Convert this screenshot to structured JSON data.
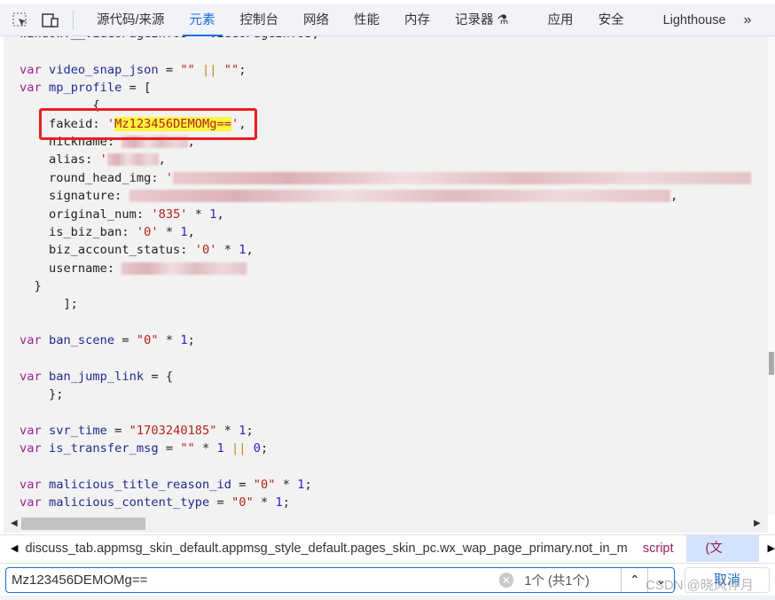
{
  "tabs": [
    "源代码/来源",
    "元素",
    "控制台",
    "网络",
    "性能",
    "内存",
    "记录器",
    "应用",
    "安全",
    "Lighthouse"
  ],
  "active_tab": "元素",
  "toolbar_icons": [
    "inspect-element-icon",
    "device-toolbar-icon",
    "flask-icon",
    "more-tabs-icon"
  ],
  "code_lines": [
    [
      [
        "p",
        "window.__videoPageInfos = videoPageInfos;"
      ]
    ],
    [],
    [
      [
        "k",
        "var "
      ],
      [
        "v",
        "video_snap_json"
      ],
      [
        "p",
        " = "
      ],
      [
        "s",
        "\"\""
      ],
      [
        "o",
        " || "
      ],
      [
        "s",
        "\"\""
      ],
      [
        "p",
        ";"
      ]
    ],
    [
      [
        "k",
        "var "
      ],
      [
        "v",
        "mp_profile"
      ],
      [
        "p",
        " = ["
      ]
    ],
    [
      [
        "p",
        "          {"
      ]
    ],
    [
      [
        "p",
        "    fakeid: "
      ],
      [
        "s",
        "'"
      ],
      [
        "h",
        "Mz123456DEMOMg=="
      ],
      [
        "s",
        "'"
      ],
      [
        "p",
        ","
      ]
    ],
    [
      [
        "p",
        "    nickname: "
      ],
      [
        "b",
        "xxxxxxxxx"
      ],
      [
        "p",
        ","
      ]
    ],
    [
      [
        "p",
        "    alias: "
      ],
      [
        "s",
        "'"
      ],
      [
        "b",
        "xxxxxxx"
      ],
      [
        "p",
        ","
      ]
    ],
    [
      [
        "p",
        "    round_head_img: "
      ],
      [
        "s",
        "'"
      ],
      [
        "b",
        "xxxxxxxxxxxxxxxxxxxxxxxxxxxxxxxxxxxxxxxxxxxxxxxxxxxxxxxxxxxxxxxxxxxxxxxxxxxxxxx"
      ]
    ],
    [
      [
        "p",
        "    signature: "
      ],
      [
        "b",
        "xxxxxxxxxxxxxxxxxxxxxxxxxxxxxxxxxxxxxxxxxxxxxxxxxxxxxxxxxxxxxxxxxxxxxxxxxx"
      ],
      [
        "p",
        ","
      ]
    ],
    [
      [
        "p",
        "    original_num: "
      ],
      [
        "s",
        "'835'"
      ],
      [
        "p",
        " * "
      ],
      [
        "n",
        "1"
      ],
      [
        "p",
        ","
      ]
    ],
    [
      [
        "p",
        "    is_biz_ban: "
      ],
      [
        "s",
        "'0'"
      ],
      [
        "p",
        " * "
      ],
      [
        "n",
        "1"
      ],
      [
        "p",
        ","
      ]
    ],
    [
      [
        "p",
        "    biz_account_status: "
      ],
      [
        "s",
        "'0'"
      ],
      [
        "p",
        " * "
      ],
      [
        "n",
        "1"
      ],
      [
        "p",
        ","
      ]
    ],
    [
      [
        "p",
        "    username: "
      ],
      [
        "b",
        "xxxxxxxxxxxxxxxxx"
      ]
    ],
    [
      [
        "p",
        "  }"
      ]
    ],
    [
      [
        "p",
        "      ];"
      ]
    ],
    [],
    [
      [
        "k",
        "var "
      ],
      [
        "v",
        "ban_scene"
      ],
      [
        "p",
        " = "
      ],
      [
        "s",
        "\"0\""
      ],
      [
        "p",
        " * "
      ],
      [
        "n",
        "1"
      ],
      [
        "p",
        ";"
      ]
    ],
    [],
    [
      [
        "k",
        "var "
      ],
      [
        "v",
        "ban_jump_link"
      ],
      [
        "p",
        " = {"
      ]
    ],
    [
      [
        "p",
        "    };"
      ]
    ],
    [],
    [
      [
        "k",
        "var "
      ],
      [
        "v",
        "svr_time"
      ],
      [
        "p",
        " = "
      ],
      [
        "s",
        "\"1703240185\""
      ],
      [
        "p",
        " * "
      ],
      [
        "n",
        "1"
      ],
      [
        "p",
        ";"
      ]
    ],
    [
      [
        "k",
        "var "
      ],
      [
        "v",
        "is_transfer_msg"
      ],
      [
        "p",
        " = "
      ],
      [
        "s",
        "\"\""
      ],
      [
        "p",
        " * "
      ],
      [
        "n",
        "1"
      ],
      [
        "o",
        " || "
      ],
      [
        "n",
        "0"
      ],
      [
        "p",
        ";"
      ]
    ],
    [],
    [
      [
        "k",
        "var "
      ],
      [
        "v",
        "malicious_title_reason_id"
      ],
      [
        "p",
        " = "
      ],
      [
        "s",
        "\"0\""
      ],
      [
        "p",
        " * "
      ],
      [
        "n",
        "1"
      ],
      [
        "p",
        ";"
      ]
    ],
    [
      [
        "k",
        "var "
      ],
      [
        "v",
        "malicious_content_type"
      ],
      [
        "p",
        " = "
      ],
      [
        "s",
        "\"0\""
      ],
      [
        "p",
        " * "
      ],
      [
        "n",
        "1"
      ],
      [
        "p",
        ";"
      ]
    ]
  ],
  "breadcrumb": {
    "path": "discuss_tab.appmsg_skin_default.appmsg_style_default.pages_skin_pc.wx_wap_page_primary.not_in_mm",
    "tag": "script",
    "selected": "(文本)"
  },
  "search": {
    "value": "Mz123456DEMOMg==",
    "match_count": "1个 (共1个)",
    "cancel_label": "取消"
  },
  "watermark": "CSDN @晓风伴月",
  "colors": {
    "accent": "#1a6fdc",
    "highlight": "#fbf53a",
    "annotation_box": "#e8201e"
  }
}
